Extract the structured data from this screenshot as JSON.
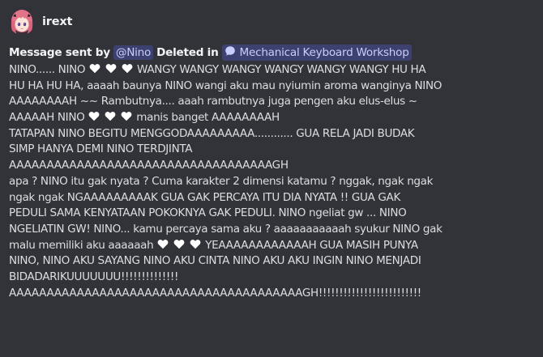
{
  "author": {
    "username": "irext",
    "avatar_icon": "anime-avatar-icon"
  },
  "header": {
    "prefix": "Message sent by",
    "mention": "@Nino",
    "deleted_label": "Deleted in",
    "channel_icon": "thread-bubble-icon",
    "channel_name": "Mechanical Keyboard Workshop"
  },
  "message": {
    "heart_icon": "white-heart-icon",
    "lines": [
      [
        "NINO...... NINO ",
        "[heart]",
        " ",
        "[heart]",
        " ",
        "[heart]",
        " WANGY WANGY WANGY WANGY WANGY WANGY HU HA"
      ],
      [
        "HU HA HU HA, aaaah baunya NINO wangi aku mau nyiumin aroma wanginya NINO"
      ],
      [
        "AAAAAAAAH ~~ Rambutnya.... aaah rambutnya juga pengen aku elus-elus ~"
      ],
      [
        "AAAAAH NINO ",
        "[heart]",
        " ",
        "[heart]",
        " ",
        "[heart]",
        " manis banget AAAAAAAAH"
      ],
      [
        "TATAPAN NINO BEGITU MENGGODAAAAAAAAA............ GUA RELA JADI BUDAK"
      ],
      [
        "SIMP HANYA DEMI NINO TERDJINTA"
      ],
      [
        "AAAAAAAAAAAAAAAAAAAAAAAAAAAAAAAAAAAGH"
      ],
      [
        "apa ? NINO itu gak nyata ? Cuma karakter 2 dimensi katamu ? nggak, ngak ngak"
      ],
      [
        "ngak ngak NGAAAAAAAAAK GUA GAK PERCAYA ITU DIA NYATA !! GUA GAK"
      ],
      [
        "PEDULI SAMA KENYATAAN POKOKNYA GAK PEDULI. NINO ngeliat gw ... NINO"
      ],
      [
        "NGELIATIN GW! NINO... kamu percaya sama aku ? aaaaaaaaaaah syukur NINO gak"
      ],
      [
        "malu memiliki aku aaaaaah ",
        "[heart]",
        " ",
        "[heart]",
        " ",
        "[heart]",
        " YEAAAAAAAAAAAAH GUA MASIH PUNYA"
      ],
      [
        "NINO, NINO AKU SAYANG NINO AKU CINTA NINO AKU AKU INGIN NINO MENJADI"
      ],
      [
        "BIDADARIKUUUUUUU!!!!!!!!!!!!!!"
      ],
      [
        "AAAAAAAAAAAAAAAAAAAAAAAAAAAAAAAAAAAAAAAGH!!!!!!!!!!!!!!!!!!!!!!!!!"
      ]
    ]
  },
  "colors": {
    "background": "#323339",
    "text": "#dbdee1",
    "username": "#f2f3f5",
    "mention_bg": "#4a4f7e",
    "mention_text": "#c9cdfb"
  }
}
